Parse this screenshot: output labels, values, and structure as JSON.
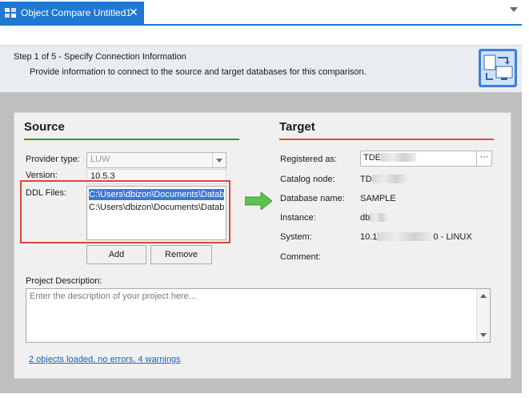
{
  "tab": {
    "title": "Object Compare Untitled1",
    "close": "✕"
  },
  "header": {
    "step": "Step 1 of 5 - Specify Connection Information",
    "description": "Provide information to connect to the source and target databases for this comparison."
  },
  "source": {
    "title": "Source",
    "provider_label": "Provider type:",
    "provider_value": "LUW",
    "version_label": "Version:",
    "version_value": "10.5.3",
    "ddl_label": "DDL Files:",
    "ddl_files": [
      "C:\\Users\\dbizon\\Documents\\Datab",
      "C:\\Users\\dbizon\\Documents\\Datab"
    ],
    "add_label": "Add",
    "remove_label": "Remove"
  },
  "target": {
    "title": "Target",
    "registered_label": "Registered as:",
    "registered_value": "TDE",
    "catalog_label": "Catalog node:",
    "catalog_value": "TD",
    "database_label": "Database name:",
    "database_value": "SAMPLE",
    "instance_label": "Instance:",
    "instance_value": "db",
    "system_label": "System:",
    "system_value_prefix": "10.1",
    "system_value_suffix": "0 - LINUX",
    "comment_label": "Comment:",
    "browse_label": "···"
  },
  "project": {
    "description_label": "Project Description:",
    "description_placeholder": "Enter the description of your project here..."
  },
  "status": {
    "link": "2 objects loaded, no errors, 4 warnings"
  },
  "colors": {
    "accent": "#1f78d1",
    "source_rule": "#2e9b2e",
    "target_rule": "#e04a3a",
    "highlight": "#e0453b",
    "selection": "#3b79d6"
  }
}
